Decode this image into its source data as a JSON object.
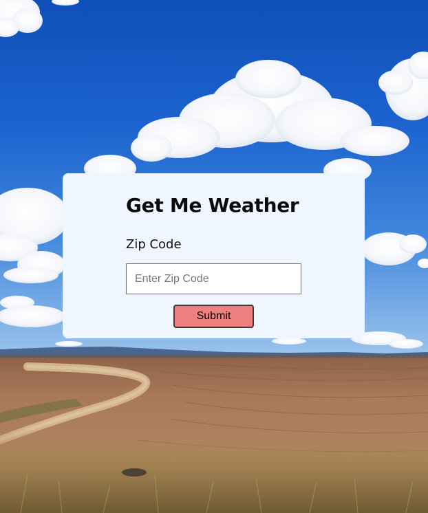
{
  "app": {
    "title": "Get Me Weather"
  },
  "form": {
    "zip_label": "Zip Code",
    "zip_placeholder": "Enter Zip Code",
    "zip_value": "",
    "submit_label": "Submit"
  },
  "colors": {
    "card_background": "#eff6ff",
    "submit_background": "#f08080",
    "sky": "#1a5fc8",
    "field": "#a9764e"
  }
}
